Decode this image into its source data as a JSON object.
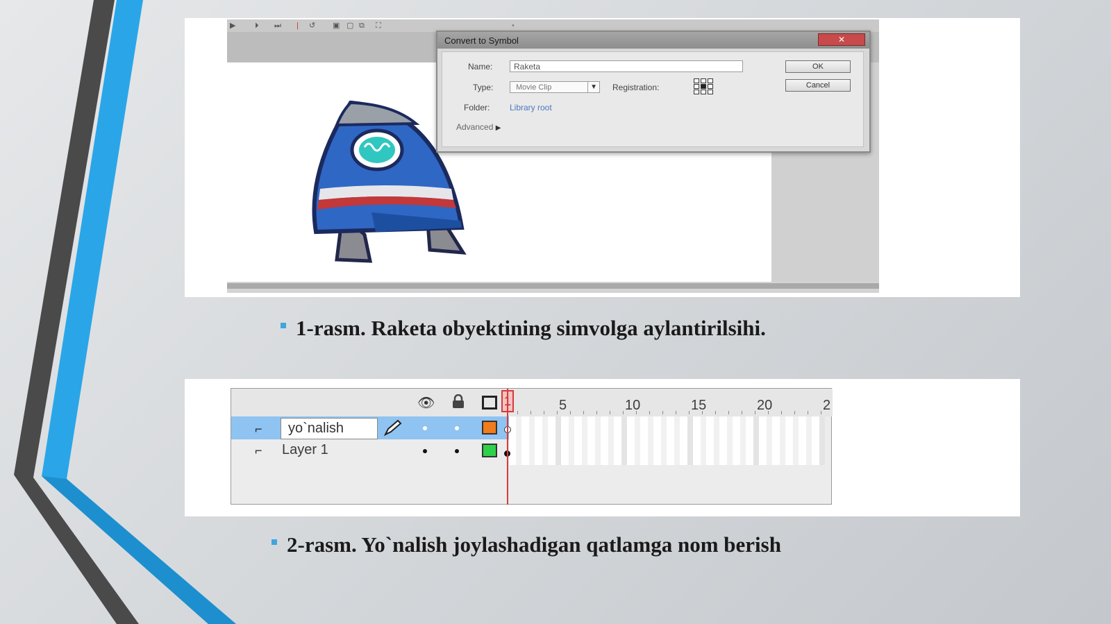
{
  "figure1": {
    "dialog": {
      "title": "Convert to Symbol",
      "close_label": "✕",
      "name_label": "Name:",
      "name_value": "Raketa",
      "type_label": "Type:",
      "type_value": "Movie Clip",
      "registration_label": "Registration:",
      "folder_label": "Folder:",
      "folder_value": "Library root",
      "advanced_label": "Advanced",
      "ok_label": "OK",
      "cancel_label": "Cancel"
    },
    "caption": "1-rasm. Raketa obyektining simvolga aylantirilsihi."
  },
  "figure2": {
    "ruler_numbers": [
      "1",
      "5",
      "10",
      "15",
      "20",
      "2"
    ],
    "layers": [
      {
        "name": "yo`nalish",
        "selected": true,
        "color": "#f07c1c"
      },
      {
        "name": "Layer 1",
        "selected": false,
        "color": "#2fd04a"
      }
    ],
    "caption": "2-rasm. Yo`nalish joylashadigan qatlamga nom berish"
  },
  "colors": {
    "accent_blue": "#2aa6e8",
    "accent_dark": "#4a4a4a",
    "layer_selected": "#8fc3f2",
    "playhead": "#d63b3b"
  }
}
